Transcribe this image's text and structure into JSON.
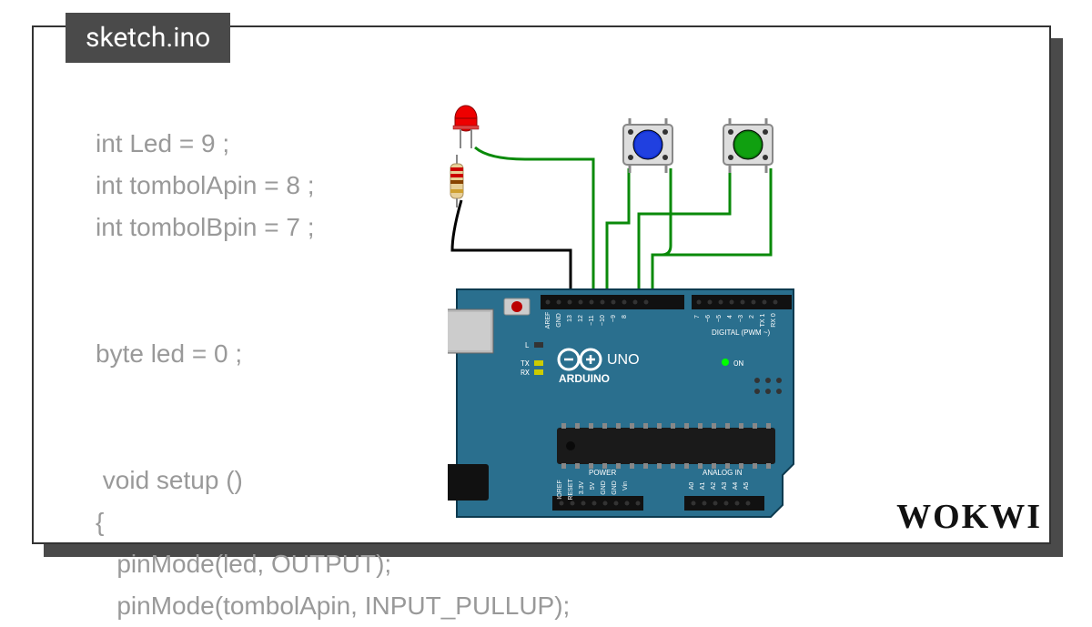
{
  "tab": {
    "label": "sketch.ino"
  },
  "code": {
    "lines": "int Led = 9 ;\nint tombolApin = 8 ;\nint tombolBpin = 7 ;\n\n\nbyte led = 0 ;\n\n\n void setup ()\n{\n   pinMode(led, OUTPUT);\n   pinMode(tombolApin, INPUT_PULLUP);"
  },
  "brand": {
    "name": "WOKWI"
  },
  "board": {
    "name": "ARDUINO",
    "model": "UNO",
    "labels": {
      "digital_header": "DIGITAL (PWM ~)",
      "analog_header": "ANALOG IN",
      "power_header": "POWER",
      "tx": "TX",
      "rx": "RX",
      "l": "L",
      "on": "ON",
      "pins_digital": [
        "AREF",
        "GND",
        "13",
        "12",
        "~11",
        "~10",
        "~9",
        "8",
        "7",
        "~6",
        "~5",
        "4",
        "~3",
        "2",
        "TX 1",
        "RX 0"
      ],
      "pins_power": [
        "IOREF",
        "RESET",
        "3.3V",
        "5V",
        "GND",
        "GND",
        "Vin"
      ],
      "pins_analog": [
        "A0",
        "A1",
        "A2",
        "A3",
        "A4",
        "A5"
      ]
    }
  },
  "components": {
    "led": {
      "color": "red",
      "connected_pin": "9"
    },
    "resistor": {},
    "button_a": {
      "color": "blue",
      "connected_pin": "8"
    },
    "button_b": {
      "color": "green",
      "connected_pin": "7"
    }
  },
  "wires": [
    {
      "from": "resistor",
      "to": "GND",
      "color": "black"
    },
    {
      "from": "led",
      "to": "pin9",
      "color": "green"
    },
    {
      "from": "button_a",
      "to": "pin8",
      "color": "green"
    },
    {
      "from": "button_b",
      "to": "pin7",
      "color": "green"
    }
  ]
}
